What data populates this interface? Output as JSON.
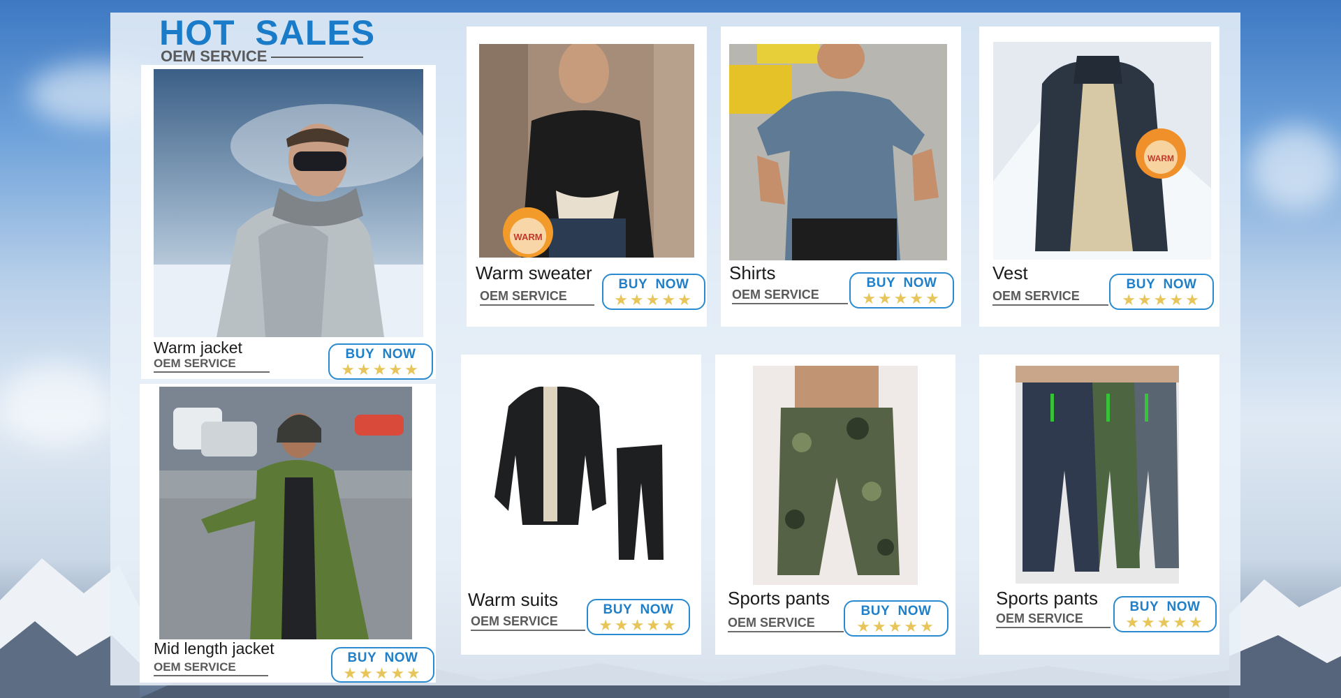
{
  "header": {
    "title": "HOT  SALES",
    "subtitle": "OEM SERVICE"
  },
  "products": [
    {
      "name": "Warm jacket",
      "sub": "OEM SERVICE",
      "buy": "BUY  NOW",
      "stars": "★★★★★"
    },
    {
      "name": "Mid length jacket",
      "sub": "OEM SERVICE",
      "buy": "BUY  NOW",
      "stars": "★★★★★"
    },
    {
      "name": "Warm sweater",
      "sub": "OEM SERVICE",
      "buy": "BUY  NOW",
      "stars": "★★★★★",
      "badge": "WARM"
    },
    {
      "name": "Shirts",
      "sub": "OEM SERVICE",
      "buy": "BUY  NOW",
      "stars": "★★★★★"
    },
    {
      "name": "Vest",
      "sub": "OEM SERVICE",
      "buy": "BUY  NOW",
      "stars": "★★★★★",
      "badge": "WARM"
    },
    {
      "name": "Warm suits",
      "sub": "OEM SERVICE",
      "buy": "BUY  NOW",
      "stars": "★★★★★"
    },
    {
      "name": "Sports pants",
      "sub": "OEM SERVICE",
      "buy": "BUY  NOW",
      "stars": "★★★★★"
    },
    {
      "name": "Sports pants",
      "sub": "OEM SERVICE",
      "buy": "BUY  NOW",
      "stars": "★★★★★"
    }
  ],
  "colors": {
    "accent": "#1a7cc9",
    "star": "#e8c55a",
    "button_border": "#2a8ad0"
  }
}
